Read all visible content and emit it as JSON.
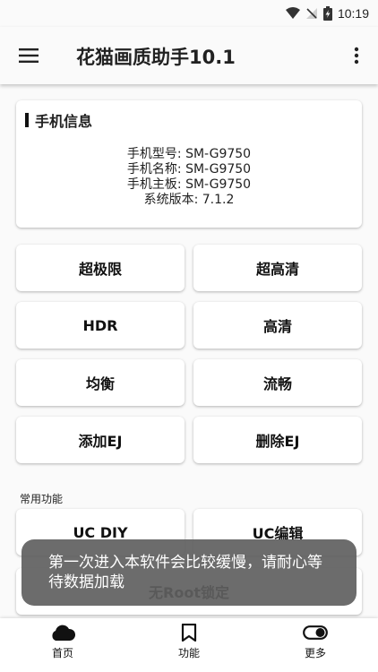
{
  "status_bar": {
    "time": "10:19",
    "icons": [
      "wifi-icon",
      "no-sim-icon",
      "battery-charging-icon"
    ]
  },
  "app_bar": {
    "title": "花猫画质助手10.1",
    "menu_icon": "hamburger-menu-icon",
    "more_icon": "more-vert-icon"
  },
  "phone_info": {
    "title": "手机信息",
    "lines": [
      "手机型号: SM-G9750",
      "手机名称: SM-G9750",
      "手机主板: SM-G9750",
      "系统版本: 7.1.2"
    ]
  },
  "quality_buttons": [
    {
      "label": "超极限"
    },
    {
      "label": "超高清"
    },
    {
      "label": "HDR"
    },
    {
      "label": "高清"
    },
    {
      "label": "均衡"
    },
    {
      "label": "流畅"
    },
    {
      "label": "添加EJ"
    },
    {
      "label": "删除EJ"
    }
  ],
  "common": {
    "section_title": "常用功能",
    "buttons": [
      {
        "label": "UC DIY"
      },
      {
        "label": "UC编辑"
      },
      {
        "label": "无Root锁定"
      }
    ]
  },
  "toast": {
    "message": "第一次进入本软件会比较缓慢，请耐心等待数据加载"
  },
  "bottom_nav": [
    {
      "label": "首页",
      "icon": "cloud-icon"
    },
    {
      "label": "功能",
      "icon": "bookmark-icon"
    },
    {
      "label": "更多",
      "icon": "toggle-icon"
    }
  ],
  "colors": {
    "background": "#fafafa",
    "card": "#ffffff",
    "toast": "#5f5f5f",
    "text": "#212121"
  }
}
